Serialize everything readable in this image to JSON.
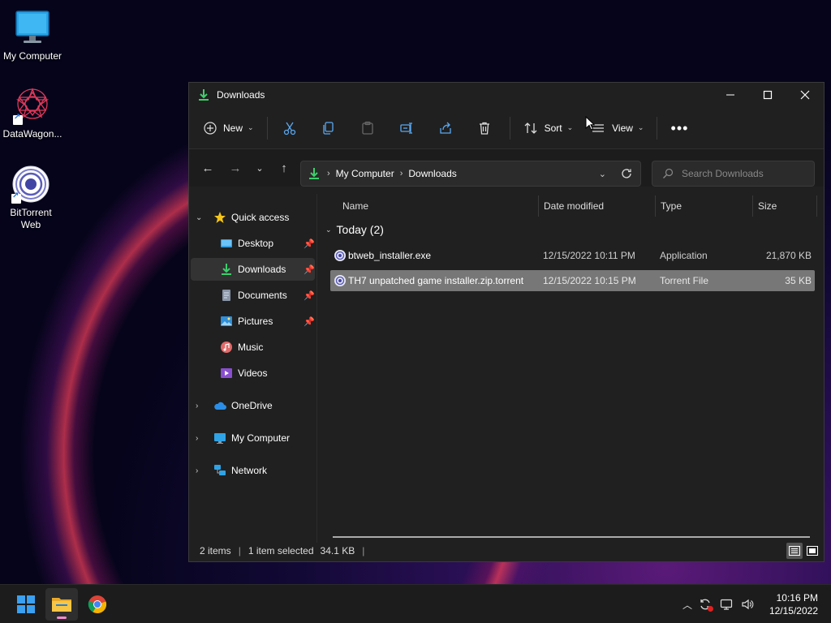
{
  "desktop": {
    "icons": [
      {
        "label": "My Computer"
      },
      {
        "label": "DataWagon..."
      },
      {
        "label": "BitTorrent\nWeb"
      }
    ]
  },
  "window": {
    "title": "Downloads",
    "toolbar": {
      "new_label": "New",
      "sort_label": "Sort",
      "view_label": "View"
    },
    "address": {
      "crumbs": [
        "My Computer",
        "Downloads"
      ]
    },
    "search": {
      "placeholder": "Search Downloads"
    },
    "nav": {
      "quick_access": "Quick access",
      "items": [
        {
          "label": "Desktop"
        },
        {
          "label": "Downloads"
        },
        {
          "label": "Documents"
        },
        {
          "label": "Pictures"
        },
        {
          "label": "Music"
        },
        {
          "label": "Videos"
        }
      ],
      "onedrive": "OneDrive",
      "my_computer": "My Computer",
      "network": "Network"
    },
    "columns": {
      "name": "Name",
      "date": "Date modified",
      "type": "Type",
      "size": "Size"
    },
    "group": {
      "label": "Today (2)"
    },
    "files": [
      {
        "name": "btweb_installer.exe",
        "date": "12/15/2022 10:11 PM",
        "type": "Application",
        "size": "21,870 KB"
      },
      {
        "name": "TH7 unpatched game installer.zip.torrent",
        "date": "12/15/2022 10:15 PM",
        "type": "Torrent File",
        "size": "35 KB"
      }
    ],
    "status": {
      "items": "2 items",
      "selected": "1 item selected",
      "size": "34.1 KB"
    }
  },
  "taskbar": {
    "time": "10:16 PM",
    "date": "12/15/2022"
  }
}
